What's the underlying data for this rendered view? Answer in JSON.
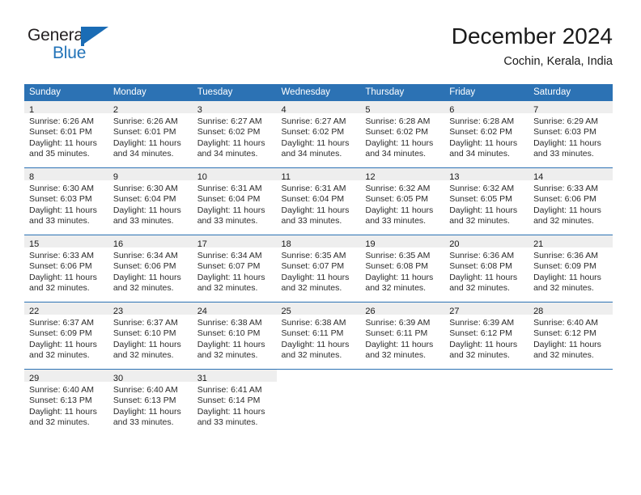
{
  "brand": {
    "name_part1": "General",
    "name_part2": "Blue",
    "flag_icon": "blue-flag-triangle",
    "accent_color": "#2273b8"
  },
  "header": {
    "title": "December 2024",
    "subtitle": "Cochin, Kerala, India"
  },
  "colors": {
    "header_blue": "#2c72b4",
    "daynum_band": "#eeeeee",
    "text": "#1a1a1a"
  },
  "weekday_headers": [
    "Sunday",
    "Monday",
    "Tuesday",
    "Wednesday",
    "Thursday",
    "Friday",
    "Saturday"
  ],
  "weeks": [
    [
      {
        "day": "1",
        "sunrise": "Sunrise: 6:26 AM",
        "sunset": "Sunset: 6:01 PM",
        "daylight1": "Daylight: 11 hours",
        "daylight2": "and 35 minutes."
      },
      {
        "day": "2",
        "sunrise": "Sunrise: 6:26 AM",
        "sunset": "Sunset: 6:01 PM",
        "daylight1": "Daylight: 11 hours",
        "daylight2": "and 34 minutes."
      },
      {
        "day": "3",
        "sunrise": "Sunrise: 6:27 AM",
        "sunset": "Sunset: 6:02 PM",
        "daylight1": "Daylight: 11 hours",
        "daylight2": "and 34 minutes."
      },
      {
        "day": "4",
        "sunrise": "Sunrise: 6:27 AM",
        "sunset": "Sunset: 6:02 PM",
        "daylight1": "Daylight: 11 hours",
        "daylight2": "and 34 minutes."
      },
      {
        "day": "5",
        "sunrise": "Sunrise: 6:28 AM",
        "sunset": "Sunset: 6:02 PM",
        "daylight1": "Daylight: 11 hours",
        "daylight2": "and 34 minutes."
      },
      {
        "day": "6",
        "sunrise": "Sunrise: 6:28 AM",
        "sunset": "Sunset: 6:02 PM",
        "daylight1": "Daylight: 11 hours",
        "daylight2": "and 34 minutes."
      },
      {
        "day": "7",
        "sunrise": "Sunrise: 6:29 AM",
        "sunset": "Sunset: 6:03 PM",
        "daylight1": "Daylight: 11 hours",
        "daylight2": "and 33 minutes."
      }
    ],
    [
      {
        "day": "8",
        "sunrise": "Sunrise: 6:30 AM",
        "sunset": "Sunset: 6:03 PM",
        "daylight1": "Daylight: 11 hours",
        "daylight2": "and 33 minutes."
      },
      {
        "day": "9",
        "sunrise": "Sunrise: 6:30 AM",
        "sunset": "Sunset: 6:04 PM",
        "daylight1": "Daylight: 11 hours",
        "daylight2": "and 33 minutes."
      },
      {
        "day": "10",
        "sunrise": "Sunrise: 6:31 AM",
        "sunset": "Sunset: 6:04 PM",
        "daylight1": "Daylight: 11 hours",
        "daylight2": "and 33 minutes."
      },
      {
        "day": "11",
        "sunrise": "Sunrise: 6:31 AM",
        "sunset": "Sunset: 6:04 PM",
        "daylight1": "Daylight: 11 hours",
        "daylight2": "and 33 minutes."
      },
      {
        "day": "12",
        "sunrise": "Sunrise: 6:32 AM",
        "sunset": "Sunset: 6:05 PM",
        "daylight1": "Daylight: 11 hours",
        "daylight2": "and 33 minutes."
      },
      {
        "day": "13",
        "sunrise": "Sunrise: 6:32 AM",
        "sunset": "Sunset: 6:05 PM",
        "daylight1": "Daylight: 11 hours",
        "daylight2": "and 32 minutes."
      },
      {
        "day": "14",
        "sunrise": "Sunrise: 6:33 AM",
        "sunset": "Sunset: 6:06 PM",
        "daylight1": "Daylight: 11 hours",
        "daylight2": "and 32 minutes."
      }
    ],
    [
      {
        "day": "15",
        "sunrise": "Sunrise: 6:33 AM",
        "sunset": "Sunset: 6:06 PM",
        "daylight1": "Daylight: 11 hours",
        "daylight2": "and 32 minutes."
      },
      {
        "day": "16",
        "sunrise": "Sunrise: 6:34 AM",
        "sunset": "Sunset: 6:06 PM",
        "daylight1": "Daylight: 11 hours",
        "daylight2": "and 32 minutes."
      },
      {
        "day": "17",
        "sunrise": "Sunrise: 6:34 AM",
        "sunset": "Sunset: 6:07 PM",
        "daylight1": "Daylight: 11 hours",
        "daylight2": "and 32 minutes."
      },
      {
        "day": "18",
        "sunrise": "Sunrise: 6:35 AM",
        "sunset": "Sunset: 6:07 PM",
        "daylight1": "Daylight: 11 hours",
        "daylight2": "and 32 minutes."
      },
      {
        "day": "19",
        "sunrise": "Sunrise: 6:35 AM",
        "sunset": "Sunset: 6:08 PM",
        "daylight1": "Daylight: 11 hours",
        "daylight2": "and 32 minutes."
      },
      {
        "day": "20",
        "sunrise": "Sunrise: 6:36 AM",
        "sunset": "Sunset: 6:08 PM",
        "daylight1": "Daylight: 11 hours",
        "daylight2": "and 32 minutes."
      },
      {
        "day": "21",
        "sunrise": "Sunrise: 6:36 AM",
        "sunset": "Sunset: 6:09 PM",
        "daylight1": "Daylight: 11 hours",
        "daylight2": "and 32 minutes."
      }
    ],
    [
      {
        "day": "22",
        "sunrise": "Sunrise: 6:37 AM",
        "sunset": "Sunset: 6:09 PM",
        "daylight1": "Daylight: 11 hours",
        "daylight2": "and 32 minutes."
      },
      {
        "day": "23",
        "sunrise": "Sunrise: 6:37 AM",
        "sunset": "Sunset: 6:10 PM",
        "daylight1": "Daylight: 11 hours",
        "daylight2": "and 32 minutes."
      },
      {
        "day": "24",
        "sunrise": "Sunrise: 6:38 AM",
        "sunset": "Sunset: 6:10 PM",
        "daylight1": "Daylight: 11 hours",
        "daylight2": "and 32 minutes."
      },
      {
        "day": "25",
        "sunrise": "Sunrise: 6:38 AM",
        "sunset": "Sunset: 6:11 PM",
        "daylight1": "Daylight: 11 hours",
        "daylight2": "and 32 minutes."
      },
      {
        "day": "26",
        "sunrise": "Sunrise: 6:39 AM",
        "sunset": "Sunset: 6:11 PM",
        "daylight1": "Daylight: 11 hours",
        "daylight2": "and 32 minutes."
      },
      {
        "day": "27",
        "sunrise": "Sunrise: 6:39 AM",
        "sunset": "Sunset: 6:12 PM",
        "daylight1": "Daylight: 11 hours",
        "daylight2": "and 32 minutes."
      },
      {
        "day": "28",
        "sunrise": "Sunrise: 6:40 AM",
        "sunset": "Sunset: 6:12 PM",
        "daylight1": "Daylight: 11 hours",
        "daylight2": "and 32 minutes."
      }
    ],
    [
      {
        "day": "29",
        "sunrise": "Sunrise: 6:40 AM",
        "sunset": "Sunset: 6:13 PM",
        "daylight1": "Daylight: 11 hours",
        "daylight2": "and 32 minutes."
      },
      {
        "day": "30",
        "sunrise": "Sunrise: 6:40 AM",
        "sunset": "Sunset: 6:13 PM",
        "daylight1": "Daylight: 11 hours",
        "daylight2": "and 33 minutes."
      },
      {
        "day": "31",
        "sunrise": "Sunrise: 6:41 AM",
        "sunset": "Sunset: 6:14 PM",
        "daylight1": "Daylight: 11 hours",
        "daylight2": "and 33 minutes."
      },
      {
        "day": "",
        "sunrise": "",
        "sunset": "",
        "daylight1": "",
        "daylight2": ""
      },
      {
        "day": "",
        "sunrise": "",
        "sunset": "",
        "daylight1": "",
        "daylight2": ""
      },
      {
        "day": "",
        "sunrise": "",
        "sunset": "",
        "daylight1": "",
        "daylight2": ""
      },
      {
        "day": "",
        "sunrise": "",
        "sunset": "",
        "daylight1": "",
        "daylight2": ""
      }
    ]
  ]
}
